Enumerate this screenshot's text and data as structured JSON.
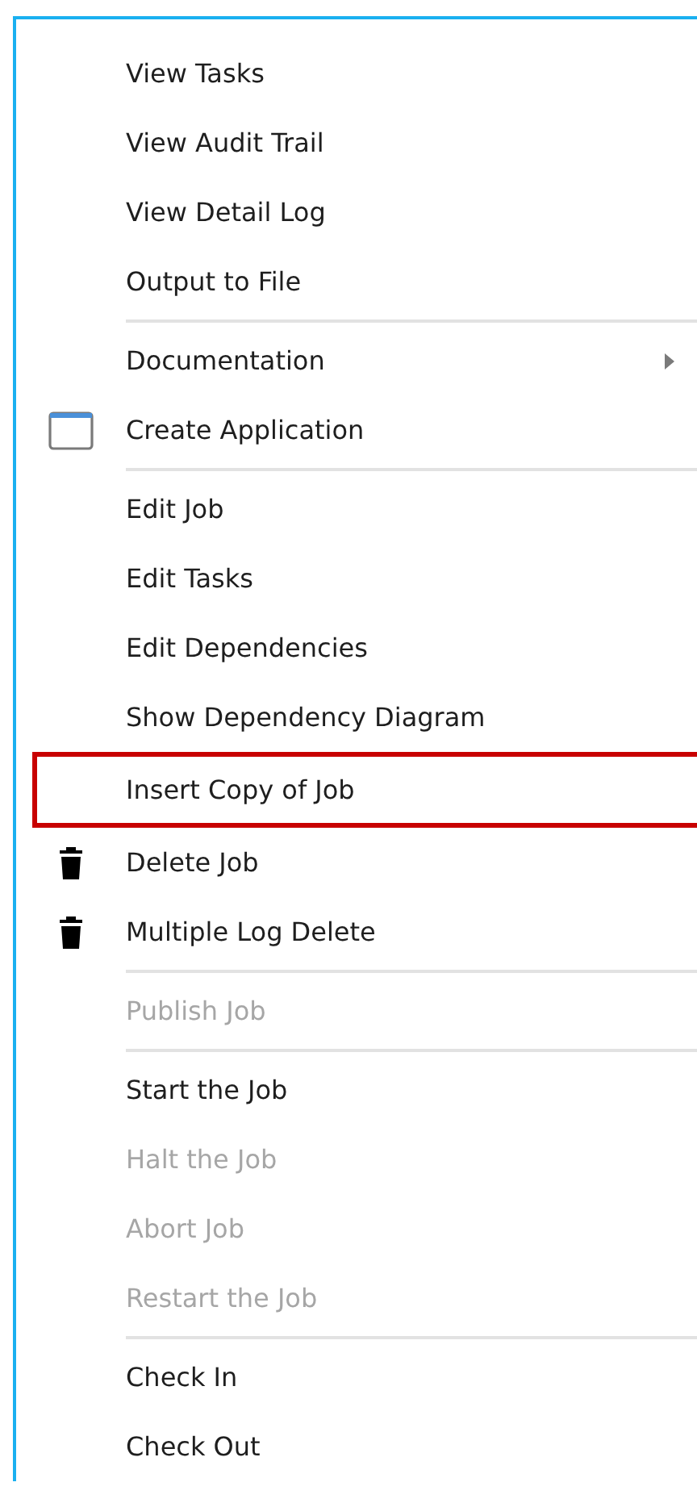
{
  "menu": {
    "groups": [
      {
        "items": [
          {
            "label": "View Tasks",
            "kind": "plain",
            "disabled": false,
            "submenu": false,
            "selected": false
          },
          {
            "label": "View Audit Trail",
            "kind": "plain",
            "disabled": false,
            "submenu": false,
            "selected": false
          },
          {
            "label": "View Detail Log",
            "kind": "plain",
            "disabled": false,
            "submenu": false,
            "selected": false
          },
          {
            "label": "Output to File",
            "kind": "plain",
            "disabled": false,
            "submenu": false,
            "selected": false
          }
        ]
      },
      {
        "items": [
          {
            "label": "Documentation",
            "kind": "plain",
            "disabled": false,
            "submenu": true,
            "selected": false
          },
          {
            "label": "Create Application",
            "kind": "window",
            "disabled": false,
            "submenu": false,
            "selected": false
          }
        ]
      },
      {
        "items": [
          {
            "label": "Edit Job",
            "kind": "plain",
            "disabled": false,
            "submenu": false,
            "selected": false
          },
          {
            "label": "Edit Tasks",
            "kind": "plain",
            "disabled": false,
            "submenu": false,
            "selected": false
          },
          {
            "label": "Edit Dependencies",
            "kind": "plain",
            "disabled": false,
            "submenu": false,
            "selected": false
          },
          {
            "label": "Show Dependency Diagram",
            "kind": "plain",
            "disabled": false,
            "submenu": false,
            "selected": false
          },
          {
            "label": "Insert Copy of Job",
            "kind": "plain",
            "disabled": false,
            "submenu": false,
            "selected": true
          },
          {
            "label": "Delete Job",
            "kind": "trash",
            "disabled": false,
            "submenu": false,
            "selected": false
          },
          {
            "label": "Multiple Log Delete",
            "kind": "trash",
            "disabled": false,
            "submenu": false,
            "selected": false
          }
        ]
      },
      {
        "items": [
          {
            "label": "Publish Job",
            "kind": "plain",
            "disabled": true,
            "submenu": false,
            "selected": false
          }
        ]
      },
      {
        "items": [
          {
            "label": "Start the Job",
            "kind": "plain",
            "disabled": false,
            "submenu": false,
            "selected": false
          },
          {
            "label": "Halt the Job",
            "kind": "plain",
            "disabled": true,
            "submenu": false,
            "selected": false
          },
          {
            "label": "Abort Job",
            "kind": "plain",
            "disabled": true,
            "submenu": false,
            "selected": false
          },
          {
            "label": "Restart the Job",
            "kind": "plain",
            "disabled": true,
            "submenu": false,
            "selected": false
          }
        ]
      },
      {
        "items": [
          {
            "label": "Check In",
            "kind": "plain",
            "disabled": false,
            "submenu": false,
            "selected": false
          },
          {
            "label": "Check Out",
            "kind": "plain",
            "disabled": false,
            "submenu": false,
            "selected": false
          }
        ]
      }
    ]
  }
}
